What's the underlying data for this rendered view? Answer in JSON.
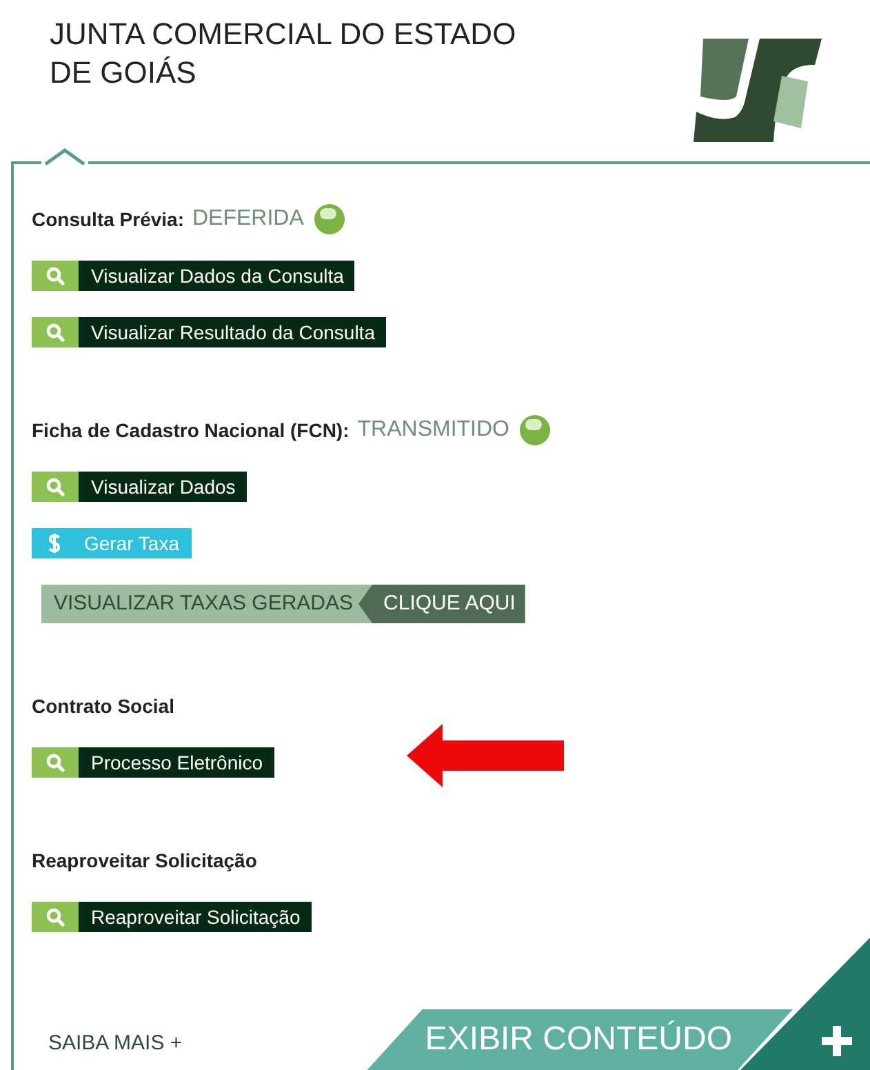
{
  "header": {
    "title": "JUNTA COMERCIAL DO ESTADO DE GOIÁS"
  },
  "sections": [
    {
      "label": "Consulta Prévia:",
      "status": "DEFERIDA",
      "color": "#7cb342",
      "actions": [
        {
          "kind": "search",
          "label": "Visualizar Dados da Consulta"
        },
        {
          "kind": "search",
          "label": "Visualizar Resultado da Consulta"
        }
      ]
    },
    {
      "label": "Ficha de Cadastro Nacional (FCN):",
      "status": "TRANSMITIDO",
      "color": "#7cb342",
      "actions": [
        {
          "kind": "search",
          "label": "Visualizar Dados"
        },
        {
          "kind": "money",
          "label": "Gerar Taxa"
        },
        {
          "kind": "split",
          "label": "VISUALIZAR TAXAS GERADAS",
          "action": "CLIQUE AQUI"
        }
      ]
    },
    {
      "label": "Contrato Social",
      "highlighted": true,
      "actions": [
        {
          "kind": "search",
          "label": "Processo Eletrônico"
        }
      ]
    },
    {
      "label": "Reaproveitar Solicitação",
      "actions": [
        {
          "kind": "search",
          "label": "Reaproveitar Solicitação"
        }
      ]
    }
  ],
  "footer": {
    "more_link": "SAIBA MAIS +",
    "toggle": "EXIBIR CONTEÚDO"
  }
}
